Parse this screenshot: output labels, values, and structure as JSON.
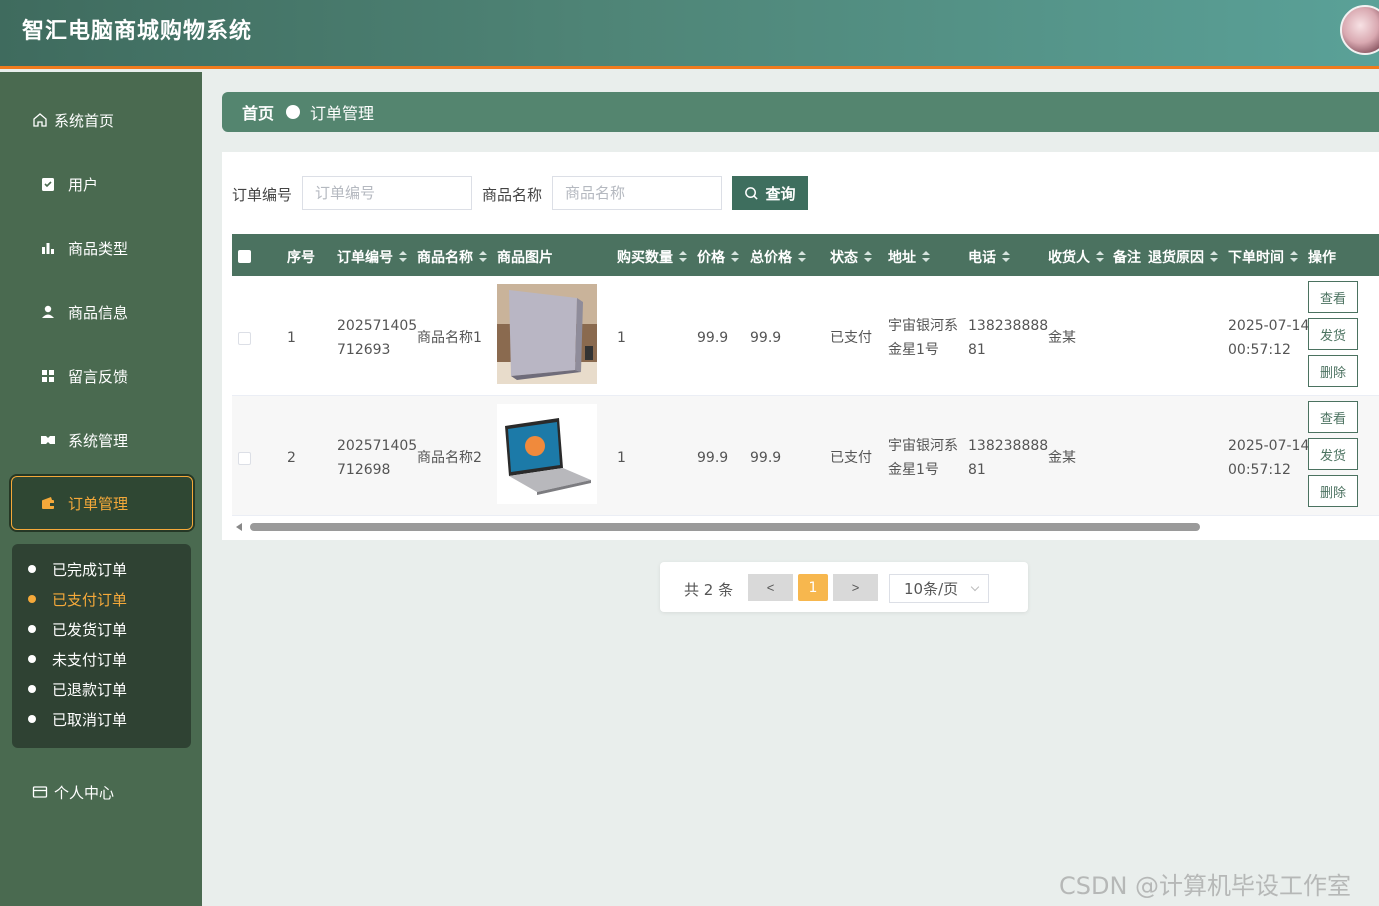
{
  "header": {
    "title": "智汇电脑商城购物系统"
  },
  "sidebar": {
    "items": [
      {
        "label": "系统首页",
        "icon": "home-icon"
      },
      {
        "label": "用户",
        "icon": "clipboard-icon"
      },
      {
        "label": "商品类型",
        "icon": "bar-chart-icon"
      },
      {
        "label": "商品信息",
        "icon": "user-icon"
      },
      {
        "label": "留言反馈",
        "icon": "grid-icon"
      },
      {
        "label": "系统管理",
        "icon": "settings-icon"
      },
      {
        "label": "订单管理",
        "icon": "wallet-icon"
      },
      {
        "label": "个人中心",
        "icon": "card-icon"
      }
    ],
    "submenu": [
      "已完成订单",
      "已支付订单",
      "已发货订单",
      "未支付订单",
      "已退款订单",
      "已取消订单"
    ]
  },
  "breadcrumb": {
    "home": "首页",
    "current": "订单管理"
  },
  "search": {
    "order_no_label": "订单编号",
    "order_no_placeholder": "订单编号",
    "product_label": "商品名称",
    "product_placeholder": "商品名称",
    "button": "查询"
  },
  "table": {
    "headers": [
      "序号",
      "订单编号",
      "商品名称",
      "商品图片",
      "购买数量",
      "价格",
      "总价格",
      "状态",
      "地址",
      "电话",
      "收货人",
      "备注",
      "退货原因",
      "下单时间",
      "操作"
    ],
    "rows": [
      {
        "index": "1",
        "order_no_1": "202571405",
        "order_no_2": "712693",
        "product": "商品名称1",
        "qty": "1",
        "price": "99.9",
        "total": "99.9",
        "status": "已支付",
        "addr_1": "宇宙银河系",
        "addr_2": "金星1号",
        "phone_1": "138238888",
        "phone_2": "81",
        "receiver": "金某",
        "time_1": "2025-07-14",
        "time_2": "00:57:12"
      },
      {
        "index": "2",
        "order_no_1": "202571405",
        "order_no_2": "712698",
        "product": "商品名称2",
        "qty": "1",
        "price": "99.9",
        "total": "99.9",
        "status": "已支付",
        "addr_1": "宇宙银河系",
        "addr_2": "金星1号",
        "phone_1": "138238888",
        "phone_2": "81",
        "receiver": "金某",
        "time_1": "2025-07-14",
        "time_2": "00:57:12"
      }
    ],
    "actions": {
      "view": "查看",
      "ship": "发货",
      "delete": "删除"
    }
  },
  "pagination": {
    "total": "共 2 条",
    "prev": "<",
    "page": "1",
    "next": ">",
    "page_size": "10条/页"
  },
  "watermark": "CSDN @计算机毕设工作室",
  "colors": {
    "header": "#4f8577",
    "sidebar": "#4a6a50",
    "accent": "#f5a93a",
    "table_header": "#4b7260"
  }
}
